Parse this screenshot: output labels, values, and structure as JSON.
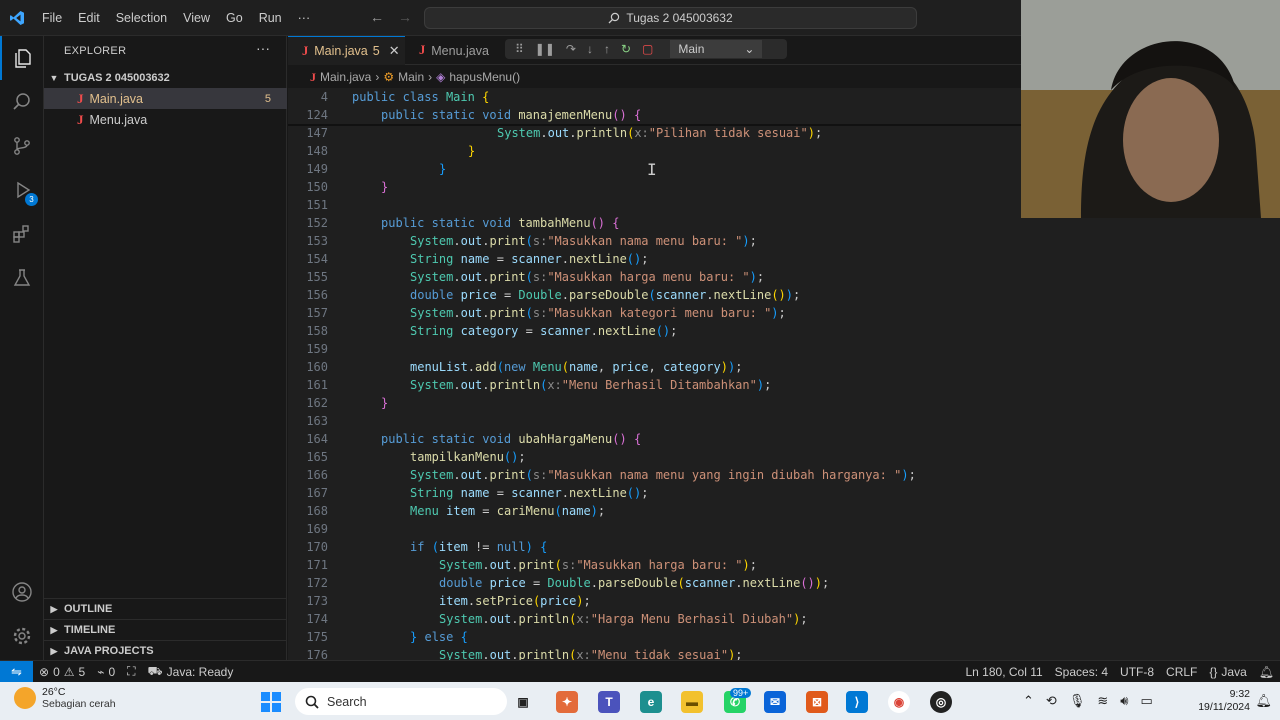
{
  "menu": [
    "File",
    "Edit",
    "Selection",
    "View",
    "Go",
    "Run",
    "···"
  ],
  "command_center": "Tugas 2 045003632",
  "explorer": {
    "title": "EXPLORER",
    "folder": "TUGAS 2 045003632",
    "files": [
      {
        "name": "Main.java",
        "problems": "5"
      },
      {
        "name": "Menu.java",
        "problems": ""
      }
    ],
    "sections": [
      "OUTLINE",
      "TIMELINE",
      "JAVA PROJECTS"
    ]
  },
  "tabs": [
    {
      "name": "Main.java",
      "badge": "5"
    },
    {
      "name": "Menu.java",
      "badge": ""
    }
  ],
  "debug_target": "Main",
  "breadcrumb": [
    "Main.java",
    "Main",
    "hapusMenu()"
  ],
  "code": [
    {
      "ln": "4",
      "html": "<span class='k'>public</span> <span class='k'>class</span> <span class='t'>Main</span> <span class='b1'>{</span>",
      "indent": 0
    },
    {
      "ln": "124",
      "html": "<span class='k'>public</span> <span class='k'>static</span> <span class='k'>void</span> <span class='f'>manajemenMenu</span><span class='b2'>()</span> <span class='b2'>{</span>",
      "indent": 1
    },
    {
      "ln": "147",
      "html": "<span class='t'>System</span>.<span class='v'>out</span>.<span class='f'>println</span><span class='b1'>(</span><span class='h'>x:</span><span class='s'>\"Pilihan tidak sesuai\"</span><span class='b1'>)</span>;",
      "indent": 5
    },
    {
      "ln": "148",
      "html": "<span class='b1'>}</span>",
      "indent": 4
    },
    {
      "ln": "149",
      "html": "<span class='b3'>}</span>",
      "indent": 3
    },
    {
      "ln": "150",
      "html": "<span class='b2'>}</span>",
      "indent": 1
    },
    {
      "ln": "151",
      "html": "",
      "indent": 0
    },
    {
      "ln": "152",
      "html": "<span class='k'>public</span> <span class='k'>static</span> <span class='k'>void</span> <span class='f'>tambahMenu</span><span class='b2'>()</span> <span class='b2'>{</span>",
      "indent": 1
    },
    {
      "ln": "153",
      "html": "<span class='t'>System</span>.<span class='v'>out</span>.<span class='f'>print</span><span class='b3'>(</span><span class='h'>s:</span><span class='s'>\"Masukkan nama menu baru: \"</span><span class='b3'>)</span>;",
      "indent": 2
    },
    {
      "ln": "154",
      "html": "<span class='t'>String</span> <span class='v'>name</span> = <span class='v'>scanner</span>.<span class='f'>nextLine</span><span class='b3'>()</span>;",
      "indent": 2
    },
    {
      "ln": "155",
      "html": "<span class='t'>System</span>.<span class='v'>out</span>.<span class='f'>print</span><span class='b3'>(</span><span class='h'>s:</span><span class='s'>\"Masukkan harga menu baru: \"</span><span class='b3'>)</span>;",
      "indent": 2
    },
    {
      "ln": "156",
      "html": "<span class='k'>double</span> <span class='v'>price</span> = <span class='t'>Double</span>.<span class='f'>parseDouble</span><span class='b3'>(</span><span class='v'>scanner</span>.<span class='f'>nextLine</span><span class='b1'>()</span><span class='b3'>)</span>;",
      "indent": 2
    },
    {
      "ln": "157",
      "html": "<span class='t'>System</span>.<span class='v'>out</span>.<span class='f'>print</span><span class='b3'>(</span><span class='h'>s:</span><span class='s'>\"Masukkan kategori menu baru: \"</span><span class='b3'>)</span>;",
      "indent": 2
    },
    {
      "ln": "158",
      "html": "<span class='t'>String</span> <span class='v'>category</span> = <span class='v'>scanner</span>.<span class='f'>nextLine</span><span class='b3'>()</span>;",
      "indent": 2
    },
    {
      "ln": "159",
      "html": "",
      "indent": 0
    },
    {
      "ln": "160",
      "html": "<span class='v'>menuList</span>.<span class='f'>add</span><span class='b3'>(</span><span class='k'>new</span> <span class='t'>Menu</span><span class='b1'>(</span><span class='v'>name</span>, <span class='v'>price</span>, <span class='v'>category</span><span class='b1'>)</span><span class='b3'>)</span>;",
      "indent": 2
    },
    {
      "ln": "161",
      "html": "<span class='t'>System</span>.<span class='v'>out</span>.<span class='f'>println</span><span class='b3'>(</span><span class='h'>x:</span><span class='s'>\"Menu Berhasil Ditambahkan\"</span><span class='b3'>)</span>;",
      "indent": 2
    },
    {
      "ln": "162",
      "html": "<span class='b2'>}</span>",
      "indent": 1
    },
    {
      "ln": "163",
      "html": "",
      "indent": 0
    },
    {
      "ln": "164",
      "html": "<span class='k'>public</span> <span class='k'>static</span> <span class='k'>void</span> <span class='f'>ubahHargaMenu</span><span class='b2'>()</span> <span class='b2'>{</span>",
      "indent": 1
    },
    {
      "ln": "165",
      "html": "<span class='f'>tampilkanMenu</span><span class='b3'>()</span>;",
      "indent": 2
    },
    {
      "ln": "166",
      "html": "<span class='t'>System</span>.<span class='v'>out</span>.<span class='f'>print</span><span class='b3'>(</span><span class='h'>s:</span><span class='s'>\"Masukkan nama menu yang ingin diubah harganya: \"</span><span class='b3'>)</span>;",
      "indent": 2
    },
    {
      "ln": "167",
      "html": "<span class='t'>String</span> <span class='v'>name</span> = <span class='v'>scanner</span>.<span class='f'>nextLine</span><span class='b3'>()</span>;",
      "indent": 2
    },
    {
      "ln": "168",
      "html": "<span class='t'>Menu</span> <span class='v'>item</span> = <span class='f'>cariMenu</span><span class='b3'>(</span><span class='v'>name</span><span class='b3'>)</span>;",
      "indent": 2
    },
    {
      "ln": "169",
      "html": "",
      "indent": 0
    },
    {
      "ln": "170",
      "html": "<span class='k'>if</span> <span class='b3'>(</span><span class='v'>item</span> != <span class='k'>null</span><span class='b3'>)</span> <span class='b3'>{</span>",
      "indent": 2
    },
    {
      "ln": "171",
      "html": "<span class='t'>System</span>.<span class='v'>out</span>.<span class='f'>print</span><span class='b1'>(</span><span class='h'>s:</span><span class='s'>\"Masukkan harga baru: \"</span><span class='b1'>)</span>;",
      "indent": 3
    },
    {
      "ln": "172",
      "html": "<span class='k'>double</span> <span class='v'>price</span> = <span class='t'>Double</span>.<span class='f'>parseDouble</span><span class='b1'>(</span><span class='v'>scanner</span>.<span class='f'>nextLine</span><span class='b2'>()</span><span class='b1'>)</span>;",
      "indent": 3
    },
    {
      "ln": "173",
      "html": "<span class='v'>item</span>.<span class='f'>setPrice</span><span class='b1'>(</span><span class='v'>price</span><span class='b1'>)</span>;",
      "indent": 3
    },
    {
      "ln": "174",
      "html": "<span class='t'>System</span>.<span class='v'>out</span>.<span class='f'>println</span><span class='b1'>(</span><span class='h'>x:</span><span class='s'>\"Harga Menu Berhasil Diubah\"</span><span class='b1'>)</span>;",
      "indent": 3
    },
    {
      "ln": "175",
      "html": "<span class='b3'>}</span> <span class='k'>else</span> <span class='b3'>{</span>",
      "indent": 2
    },
    {
      "ln": "176",
      "html": "<span class='t'>System</span>.<span class='v'>out</span>.<span class='f'>println</span><span class='b1'>(</span><span class='h'>x:</span><span class='s'>\"Menu tidak sesuai\"</span><span class='b1'>)</span>;",
      "indent": 3
    }
  ],
  "status": {
    "errors": "0",
    "warnings": "5",
    "ports": "0",
    "java": "Java: Ready",
    "position": "Ln 180, Col 11",
    "spaces": "Spaces: 4",
    "encoding": "UTF-8",
    "eol": "CRLF",
    "language": "Java"
  },
  "taskbar": {
    "temp": "26°C",
    "weather": "Sebagian cerah",
    "search_placeholder": "Search",
    "badge": "99+",
    "time": "9:32",
    "date": "19/11/2024"
  },
  "colors": {
    "accent": "#0078d4",
    "editor_bg": "#1f1f1f",
    "sidebar_bg": "#181818"
  }
}
